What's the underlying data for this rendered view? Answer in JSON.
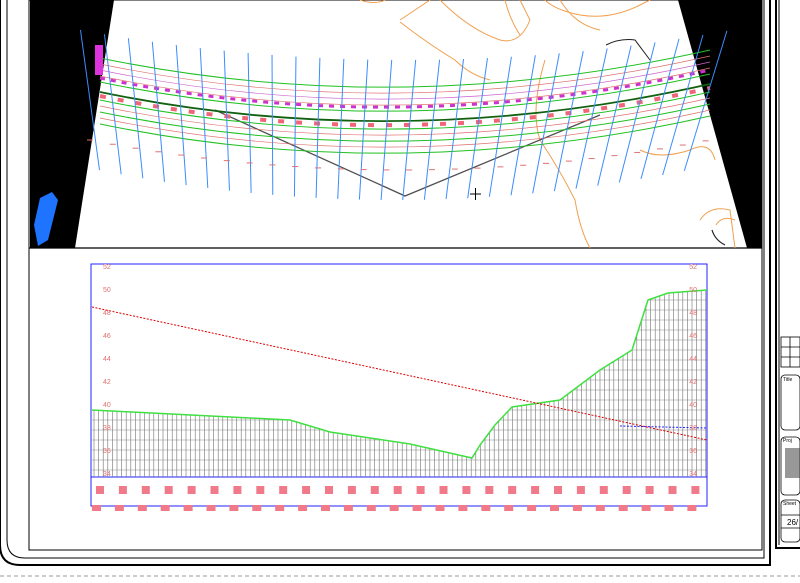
{
  "drawing": {
    "cursor_icon": "crosshair-icon",
    "colors": {
      "background": "#ffffff",
      "mask": "#000000",
      "contour": "#f0a050",
      "section_line": "#3a8cff",
      "road_edge": "#20c020",
      "centerline": "#106010",
      "boundary": "#505050",
      "profile_frame": "#2020ff",
      "ground_line": "#40e040",
      "grade_line": "#e00000",
      "hatch": "#707070",
      "label": "#e07070"
    }
  },
  "profile": {
    "y_ticks_left": [
      "52",
      "50",
      "48",
      "46",
      "44",
      "42",
      "40",
      "38",
      "36",
      "34"
    ],
    "y_ticks_right": [
      "52",
      "50",
      "48",
      "46",
      "44",
      "42",
      "40",
      "38",
      "36",
      "34"
    ]
  },
  "title_block": {
    "sheet_date": "26/"
  }
}
